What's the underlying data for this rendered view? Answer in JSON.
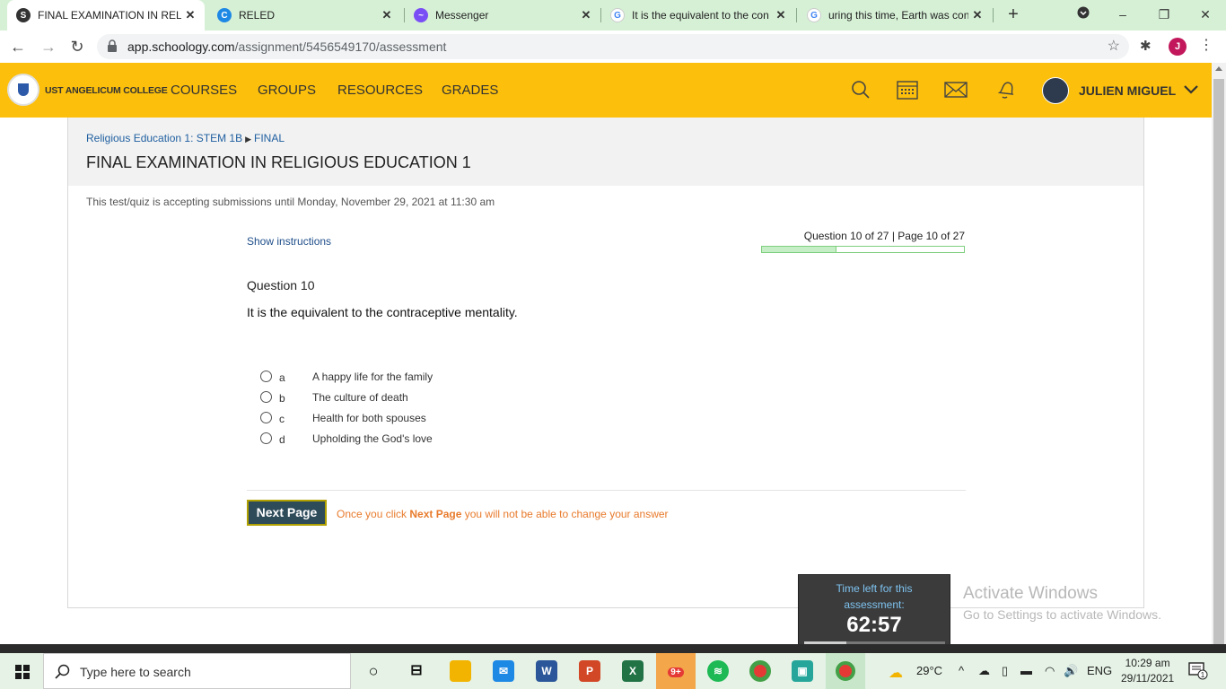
{
  "browser": {
    "tabs": [
      {
        "title": "FINAL EXAMINATION IN RELI",
        "icon": "schoology-icon"
      },
      {
        "title": "RELED",
        "icon": "c-icon"
      },
      {
        "title": "Messenger",
        "icon": "messenger-icon"
      },
      {
        "title": "It is the equivalent to the con",
        "icon": "google-icon"
      },
      {
        "title": "uring this time, Earth was con",
        "icon": "google-icon"
      }
    ],
    "url_host": "app.schoology.com",
    "url_path": "/assignment/5456549170/assessment",
    "profile_initial": "J"
  },
  "header": {
    "school_name": "UST ANGELICUM COLLEGE",
    "nav": [
      "COURSES",
      "GROUPS",
      "RESOURCES",
      "GRADES"
    ],
    "user_name": "JULIEN MIGUEL",
    "accent_color": "#fcbf0b"
  },
  "page": {
    "breadcrumb_course": "Religious Education 1: STEM 1B",
    "breadcrumb_folder": "FINAL",
    "title": "FINAL EXAMINATION IN RELIGIOUS EDUCATION 1",
    "deadline": "This test/quiz is accepting submissions until Monday, November 29, 2021 at 11:30 am",
    "show_instructions": "Show instructions",
    "progress_label": "Question 10 of 27 | Page 10 of 27",
    "progress_fraction": 0.37,
    "question_number": "Question 10",
    "question_text": "It is the equivalent to the contraceptive mentality.",
    "choices": [
      {
        "letter": "a",
        "text": "A happy life for the family"
      },
      {
        "letter": "b",
        "text": "The culture of death"
      },
      {
        "letter": "c",
        "text": "Health for both spouses"
      },
      {
        "letter": "d",
        "text": "Upholding the God's love"
      }
    ],
    "next_button": "Next Page",
    "warning_prefix": "Once you click",
    "warning_bold": "Next Page",
    "warning_suffix": "you will not be able to change your answer"
  },
  "timer": {
    "label_line1": "Time left for this",
    "label_line2": "assessment:",
    "value": "62:57",
    "fraction_remaining": 0.3
  },
  "watermark": {
    "line1": "Activate Windows",
    "line2": "Go to Settings to activate Windows."
  },
  "taskbar": {
    "search_placeholder": "Type here to search",
    "temperature": "29°C",
    "language": "ENG",
    "time": "10:29 am",
    "date": "29/11/2021",
    "notification_count": "1",
    "badge_count": "9+"
  }
}
